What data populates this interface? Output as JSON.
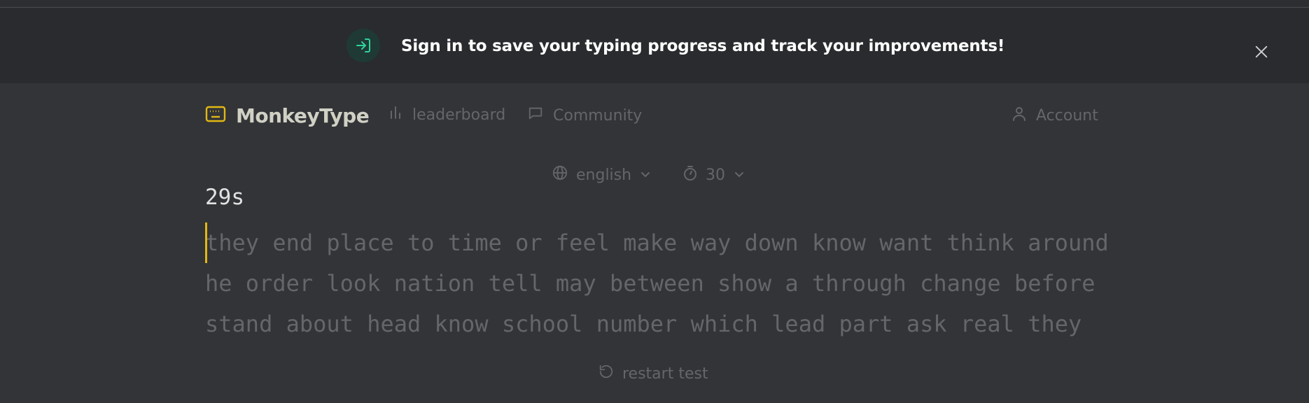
{
  "banner": {
    "text": "Sign in to save your typing progress and track your improvements!",
    "icon": "sign-in-icon",
    "accent": "#2fd39a"
  },
  "nav": {
    "brand": "MonkeyType",
    "brand_icon": "keyboard-icon",
    "brand_color": "#e2b714",
    "links": [
      {
        "label": "leaderboard",
        "icon": "bar-chart-icon"
      },
      {
        "label": "Community",
        "icon": "chat-icon"
      },
      {
        "label": "Account",
        "icon": "user-icon"
      }
    ]
  },
  "test": {
    "language": "english",
    "duration": "30",
    "timer": "29s",
    "lines": [
      "they end place to time or feel make way down know want think around",
      "he order look nation tell may between show a through change before",
      "stand about head know school number which lead part ask real they"
    ],
    "restart_label": "restart test"
  }
}
